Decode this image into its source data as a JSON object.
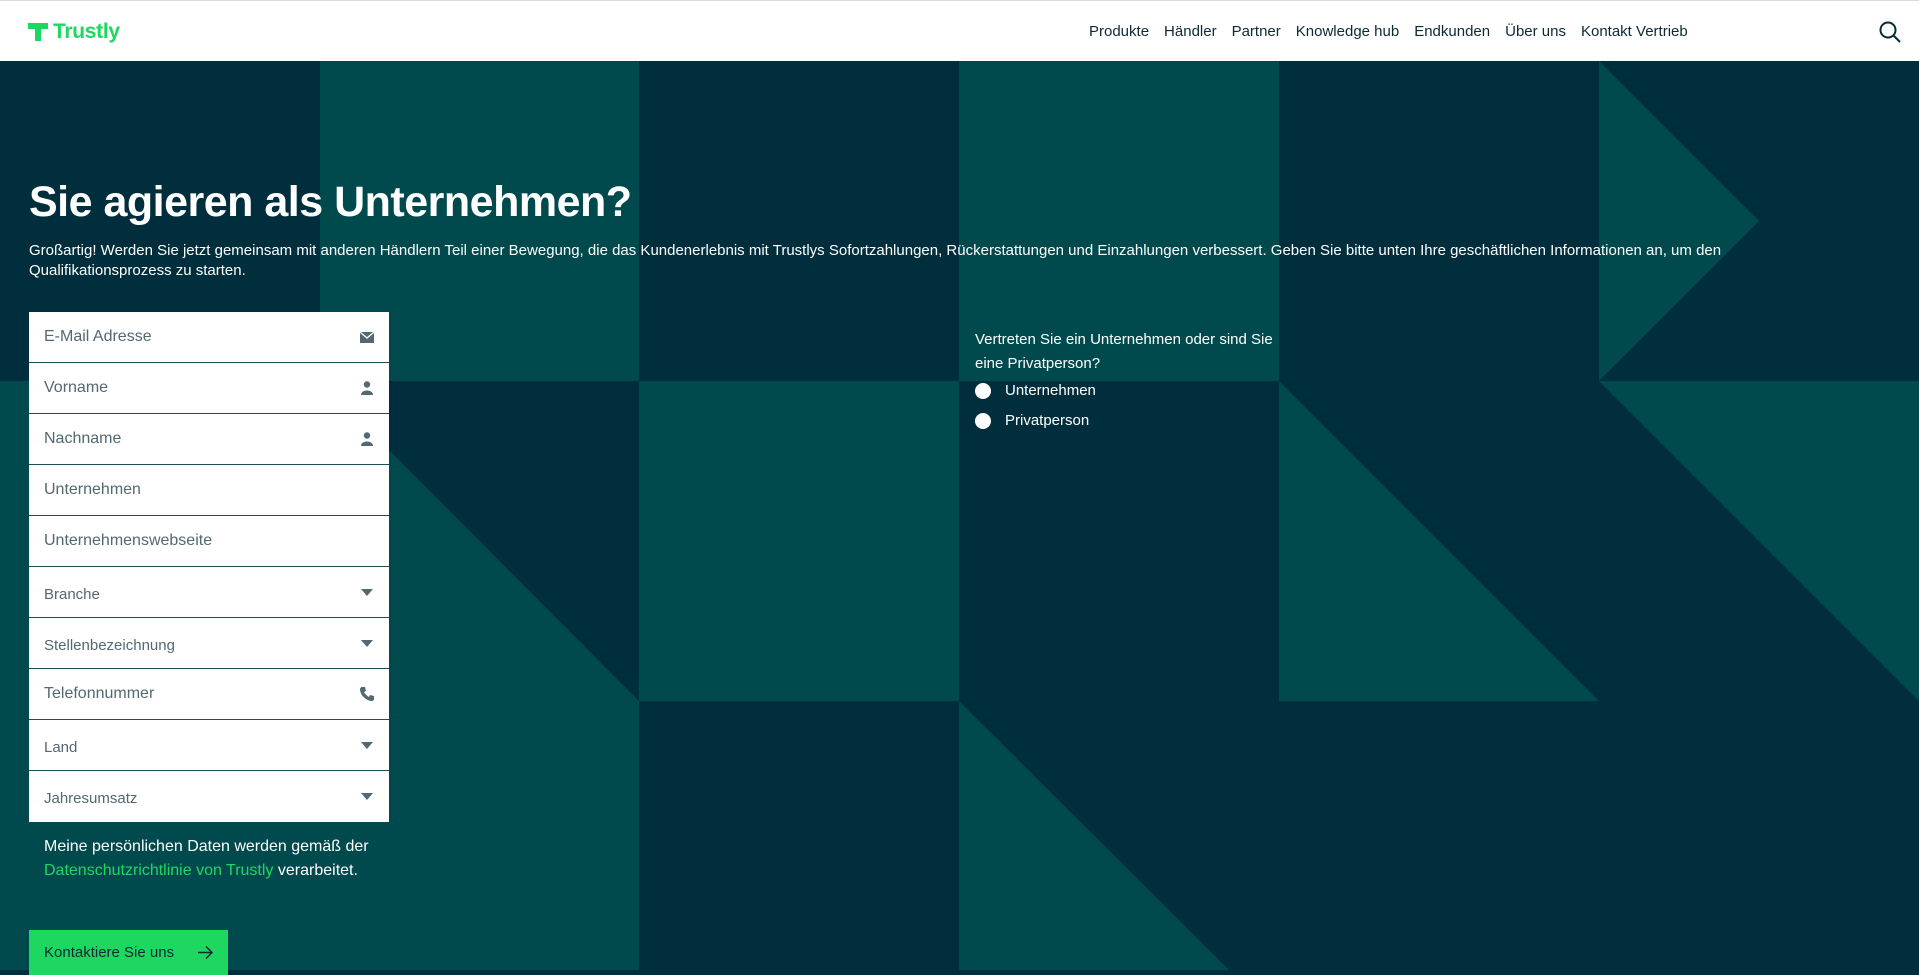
{
  "brand": {
    "name": "Trustly",
    "accent": "#1ed760",
    "dark": "#002e3c",
    "teal": "#004a4e"
  },
  "nav": {
    "items": [
      {
        "label": "Produkte"
      },
      {
        "label": "Händler"
      },
      {
        "label": "Partner"
      },
      {
        "label": "Knowledge hub"
      },
      {
        "label": "Endkunden"
      },
      {
        "label": "Über uns"
      },
      {
        "label": "Kontakt Vertrieb"
      }
    ],
    "search_icon": "search-icon"
  },
  "hero": {
    "title": "Sie agieren als Unternehmen?",
    "description": "Großartig! Werden Sie jetzt gemeinsam mit anderen Händlern Teil einer Bewegung, die das Kundenerlebnis mit Trustlys Sofortzahlungen, Rückerstattungen und Einzahlungen verbessert. Geben Sie bitte unten Ihre geschäftlichen Informationen an, um den Qualifikationsprozess zu starten."
  },
  "form": {
    "email": {
      "placeholder": "E-Mail Adresse",
      "icon": "envelope-icon"
    },
    "first_name": {
      "placeholder": "Vorname",
      "icon": "person-icon"
    },
    "last_name": {
      "placeholder": "Nachname",
      "icon": "person-icon"
    },
    "company": {
      "placeholder": "Unternehmen"
    },
    "website": {
      "placeholder": "Unternehmenswebseite"
    },
    "industry": {
      "placeholder": "Branche",
      "icon": "caret-down-icon"
    },
    "job_title": {
      "placeholder": "Stellenbezeichnung",
      "icon": "caret-down-icon"
    },
    "phone": {
      "placeholder": "Telefonnummer",
      "icon": "phone-icon"
    },
    "country": {
      "placeholder": "Land",
      "icon": "caret-down-icon"
    },
    "revenue": {
      "placeholder": "Jahresumsatz",
      "icon": "caret-down-icon"
    }
  },
  "privacy": {
    "text_before": "Meine persönlichen Daten werden gemäß der ",
    "link": "Datenschutzrichtlinie von Trustly",
    "text_after": " verarbeitet."
  },
  "cta": {
    "label": "Kontaktiere Sie uns",
    "icon": "arrow-right-icon"
  },
  "entity_type": {
    "question": "Vertreten Sie ein Unternehmen oder sind Sie eine Privatperson?",
    "options": [
      {
        "label": "Unternehmen"
      },
      {
        "label": "Privatperson"
      }
    ]
  }
}
